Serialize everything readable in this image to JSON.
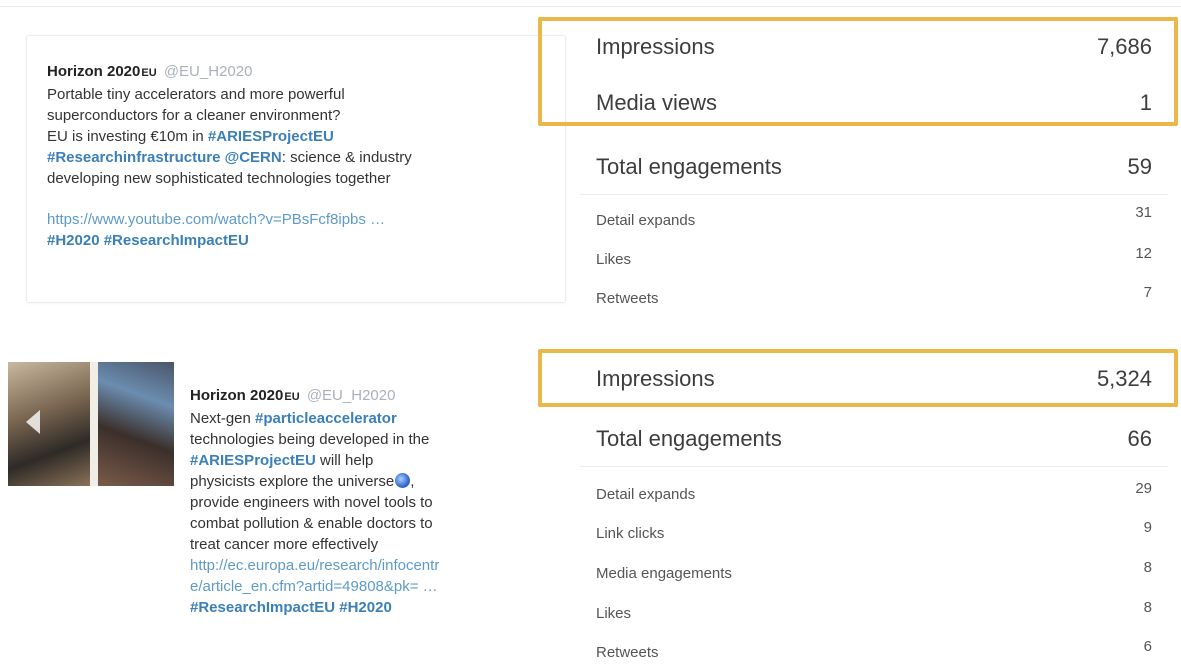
{
  "tweet1": {
    "author_name": "Horizon 2020",
    "author_badge": "EU",
    "handle": "@EU_H2020",
    "line1": "Portable tiny accelerators and more powerful",
    "line2": "superconductors for a cleaner environment?",
    "line3_text": "EU is investing €10m in ",
    "line3_tag": "#ARIESProjectEU",
    "line4_tag": "#Researchinfrastructure",
    "line4_mention": "@CERN",
    "line4_rest": ": science & industry",
    "line5": "developing new sophisticated technologies together",
    "link": "https://www.youtube.com/watch?v=PBsFcf8ipbs …",
    "tag1": "#H2020",
    "tag2": "#ResearchImpactEU"
  },
  "tweet2": {
    "author_name": "Horizon 2020",
    "author_badge": "EU",
    "handle": "@EU_H2020",
    "line1_text": "Next-gen ",
    "line1_tag": "#particleaccelerator",
    "line2": "technologies being developed in the",
    "line3_tag": "#ARIESProjectEU",
    "line3_text": " will help",
    "line4": "physicists explore the universe",
    "line4_end": ",",
    "line5": "provide engineers with novel tools to",
    "line6": "combat pollution & enable doctors to",
    "line7": "treat cancer more effectively",
    "link_line1": "http://ec.europa.eu/research/infocentr",
    "link_line2": "e/article_en.cfm?artid=49808&pk= …",
    "tag1": "#ResearchImpactEU",
    "tag2": "#H2020"
  },
  "stats1": [
    {
      "label": "Impressions",
      "value": "7,686"
    },
    {
      "label": "Media views",
      "value": "1"
    },
    {
      "label": "Total engagements",
      "value": "59"
    },
    {
      "label": "Detail expands",
      "value": "31"
    },
    {
      "label": "Likes",
      "value": "12"
    },
    {
      "label": "Retweets",
      "value": "7"
    }
  ],
  "stats2": [
    {
      "label": "Impressions",
      "value": "5,324"
    },
    {
      "label": "Total engagements",
      "value": "66"
    },
    {
      "label": "Detail expands",
      "value": "29"
    },
    {
      "label": "Link clicks",
      "value": "9"
    },
    {
      "label": "Media engagements",
      "value": "8"
    },
    {
      "label": "Likes",
      "value": "8"
    },
    {
      "label": "Retweets",
      "value": "6"
    }
  ],
  "colors": {
    "highlight": "#eab84a",
    "hashtag": "#3a7fb8",
    "link": "#5d9ac9"
  }
}
